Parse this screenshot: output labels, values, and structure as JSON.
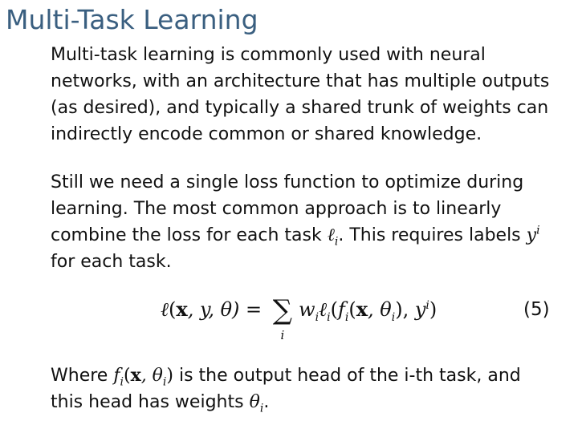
{
  "title": "Multi-Task Learning",
  "paragraph1": {
    "lines": [
      "Multi-task learning is commonly used with neural",
      "networks, with an architecture that has multiple outputs",
      "(as desired), and typically a shared trunk of weights can",
      "indirectly encode common or shared knowledge."
    ]
  },
  "paragraph2": {
    "line1": "Still we need a single loss function to optimize during",
    "line2": "learning.  The most common approach is to linearly",
    "line3_pre": "combine the loss for each task ",
    "loss_symbol": "ℓ",
    "loss_sub": "i",
    "line3_mid": ".  This requires labels ",
    "label_symbol": "y",
    "label_sup": "i",
    "line4": "for each task."
  },
  "equation": {
    "lhs_loss": "ℓ",
    "lhs_open": "(",
    "lhs_x": "x",
    "lhs_args": ", y, θ)",
    "equals": " = ",
    "sum_sign": "∑",
    "sum_index": "i",
    "term_w": "w",
    "term_w_sub": "i",
    "term_l": "ℓ",
    "term_l_sub": "i",
    "term_open": "(",
    "term_f": "f",
    "term_f_sub": "i",
    "term_f_open": "(",
    "term_x": "x",
    "term_theta": ", θ",
    "term_theta_sub": "i",
    "term_close1": "), ",
    "term_y": "y",
    "term_y_sup": "i",
    "term_close2": ")",
    "number": "(5)"
  },
  "paragraph3": {
    "line1_pre": "Where ",
    "f_symbol": "f",
    "f_sub": "i",
    "open": "(",
    "x_symbol": "x",
    "theta_part": ", θ",
    "theta_sub": "i",
    "close": ")",
    "line1_post": " is the output head of the i-th task, and",
    "line2_pre": "this head has weights ",
    "theta_symbol": "θ",
    "theta_symbol_sub": "i",
    "line2_post": "."
  }
}
